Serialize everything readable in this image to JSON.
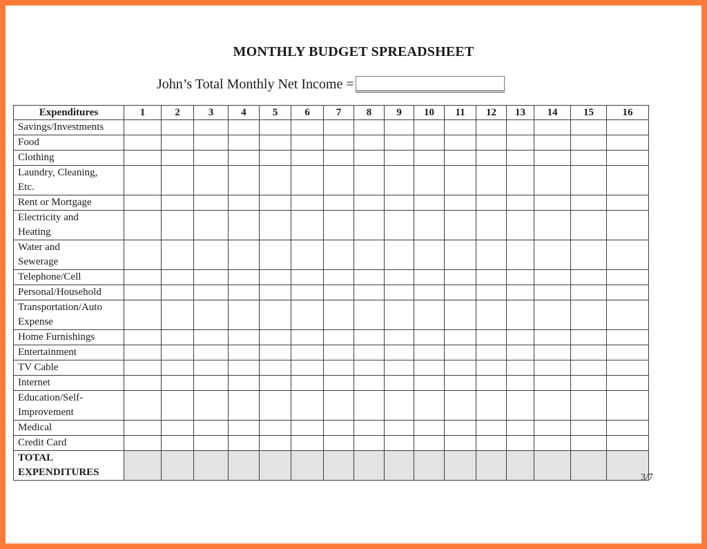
{
  "document": {
    "title": "MONTHLY BUDGET SPREADSHEET",
    "income_label": "John’s Total Monthly Net Income =",
    "income_value": "",
    "page_number": "3/7",
    "colors": {
      "frame": "#fd7b37",
      "total_row_fill": "#e3e3e3",
      "grid_line": "#3d3d3d"
    }
  },
  "table": {
    "header_label": "Expenditures",
    "columns": [
      "1",
      "2",
      "3",
      "4",
      "5",
      "6",
      "7",
      "8",
      "9",
      "10",
      "11",
      "12",
      "13",
      "14",
      "15",
      "16"
    ],
    "rows": [
      {
        "label": "Savings/Investments",
        "lines": 1
      },
      {
        "label": "Food",
        "lines": 1
      },
      {
        "label": "Clothing",
        "lines": 1
      },
      {
        "label": "Laundry, Cleaning, Etc.",
        "lines": 2
      },
      {
        "label": "Rent or Mortgage",
        "lines": 1
      },
      {
        "label": "Electricity and Heating",
        "lines": 2
      },
      {
        "label": "Water and Sewerage",
        "lines": 2
      },
      {
        "label": "Telephone/Cell",
        "lines": 1
      },
      {
        "label": "Personal/Household",
        "lines": 1
      },
      {
        "label": "Transportation/Auto Expense",
        "lines": 2
      },
      {
        "label": "Home Furnishings",
        "lines": 1
      },
      {
        "label": "Entertainment",
        "lines": 1
      },
      {
        "label": "TV Cable",
        "lines": 1
      },
      {
        "label": "Internet",
        "lines": 1
      },
      {
        "label": "Education/Self-Improvement",
        "lines": 2
      },
      {
        "label": "Medical",
        "lines": 1
      },
      {
        "label": "Credit Card",
        "lines": 1
      }
    ],
    "total_row": {
      "label": "TOTAL EXPENDITURES",
      "lines": 2
    }
  }
}
